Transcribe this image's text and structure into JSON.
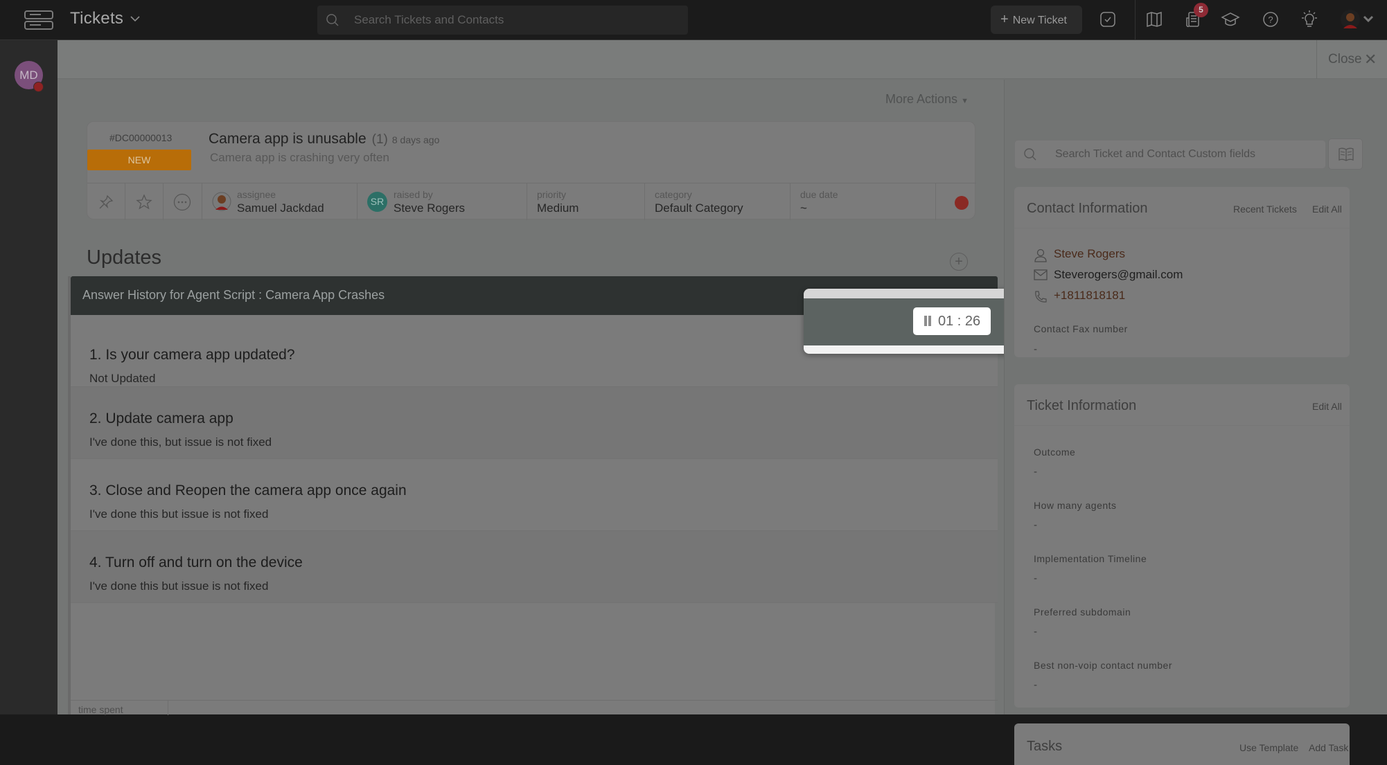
{
  "topbar": {
    "app_title": "Tickets",
    "search_placeholder": "Search Tickets and Contacts",
    "new_ticket_label": "New Ticket",
    "notification_count": "5",
    "icons": [
      "menu-icon",
      "chevron-down-icon",
      "search-icon",
      "plus-icon",
      "task-check-icon",
      "map-icon",
      "notification-feed-icon",
      "graduation-cap-icon",
      "help-icon",
      "lightbulb-icon",
      "user-avatar",
      "chevron-down-icon"
    ]
  },
  "leftrail": {
    "avatar_initials": "MD",
    "status_color": "#8f2222"
  },
  "closebar": {
    "close_label": "Close"
  },
  "ticket": {
    "more_actions": "More Actions",
    "id": "#DC00000013",
    "status": "NEW",
    "status_color": "#b86d08",
    "subject": "Camera app is unusable",
    "thread_count": "(1)",
    "age": "8 days ago",
    "description": "Camera app is crashing very often",
    "fields": {
      "assignee_label": "assignee",
      "assignee_value": "Samuel Jackdad",
      "raised_by_label": "raised by",
      "raised_by_initials": "SR",
      "raised_by_value": "Steve Rogers",
      "priority_label": "priority",
      "priority_value": "Medium",
      "category_label": "category",
      "category_value": "Default Category",
      "due_date_label": "due date",
      "due_date_value": "~"
    },
    "record_indicator_color": "#8a2a24"
  },
  "updates": {
    "title": "Updates",
    "add_symbol": "+"
  },
  "script_panel": {
    "title": "Answer History for Agent Script : Camera App Crashes",
    "minimize_symbol": "—",
    "items": [
      {
        "question": "1. Is your camera app updated?",
        "answer": "Not Updated"
      },
      {
        "question": "2. Update camera app",
        "answer": "I've done this, but issue is not fixed"
      },
      {
        "question": "3. Close and Reopen the camera app once again",
        "answer": "I've done this but issue is not fixed"
      },
      {
        "question": "4. Turn off and turn on the device",
        "answer": "I've done this but issue is not fixed"
      }
    ],
    "time_spent_label": "time spent"
  },
  "timer": {
    "value": "01 : 26",
    "state": "running"
  },
  "sidebar": {
    "search_placeholder": "Search Ticket and Contact Custom fields",
    "contact": {
      "title": "Contact Information",
      "recent_tickets": "Recent Tickets",
      "edit_all": "Edit All",
      "name": "Steve Rogers",
      "email": "Steverogers@gmail.com",
      "phone": "+1811818181",
      "fields": [
        {
          "label": "Contact Fax number",
          "value": "-"
        }
      ]
    },
    "ticket_info": {
      "title": "Ticket Information",
      "edit_all": "Edit All",
      "fields": [
        {
          "label": "Outcome",
          "value": "-"
        },
        {
          "label": "How many agents",
          "value": "-"
        },
        {
          "label": "Implementation Timeline",
          "value": "-"
        },
        {
          "label": "Preferred subdomain",
          "value": "-"
        },
        {
          "label": "Best non-voip contact number",
          "value": "-"
        }
      ]
    },
    "tasks": {
      "title": "Tasks",
      "use_template": "Use Template",
      "add_task": "Add Task"
    }
  }
}
